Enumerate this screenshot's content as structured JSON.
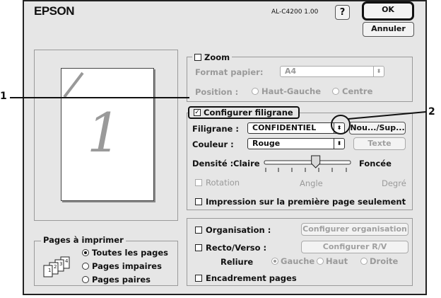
{
  "header": {
    "brand": "EPSON",
    "model": "AL-C4200 1.00",
    "help_label": "?",
    "ok_label": "OK",
    "cancel_label": "Annuler"
  },
  "preview": {
    "page_number": "1"
  },
  "zoom": {
    "label": "Zoom",
    "format_label": "Format papier:",
    "format_value": "A4",
    "position_label": "Position :",
    "position_options": [
      "Haut-Gauche",
      "Centre"
    ]
  },
  "watermark": {
    "group_label": "Configurer filigrane",
    "watermark_label": "Filigrane :",
    "watermark_value": "CONFIDENTIEL",
    "new_delete_label": "Nou.../Sup...",
    "color_label": "Couleur :",
    "color_value": "Rouge",
    "text_label": "Texte",
    "density_label": "Densité :",
    "density_light": "Claire",
    "density_dark": "Foncée",
    "density_level": 0.62,
    "rotation_label": "Rotation",
    "angle_label": "Angle",
    "degree_label": "Degré",
    "first_page_only_label": "Impression sur la première page seulement"
  },
  "pages": {
    "group_label": "Pages à imprimer",
    "options": [
      "Toutes les pages",
      "Pages impaires",
      "Pages paires"
    ]
  },
  "layout": {
    "organisation_label": "Organisation :",
    "organisation_button": "Configurer organisation",
    "duplex_label": "Recto/Verso :",
    "duplex_button": "Configurer R/V",
    "binding_label": "Reliure",
    "binding_options": [
      "Gauche",
      "Haut",
      "Droite"
    ],
    "border_label": "Encadrement pages"
  },
  "callouts": [
    "1",
    "2"
  ]
}
